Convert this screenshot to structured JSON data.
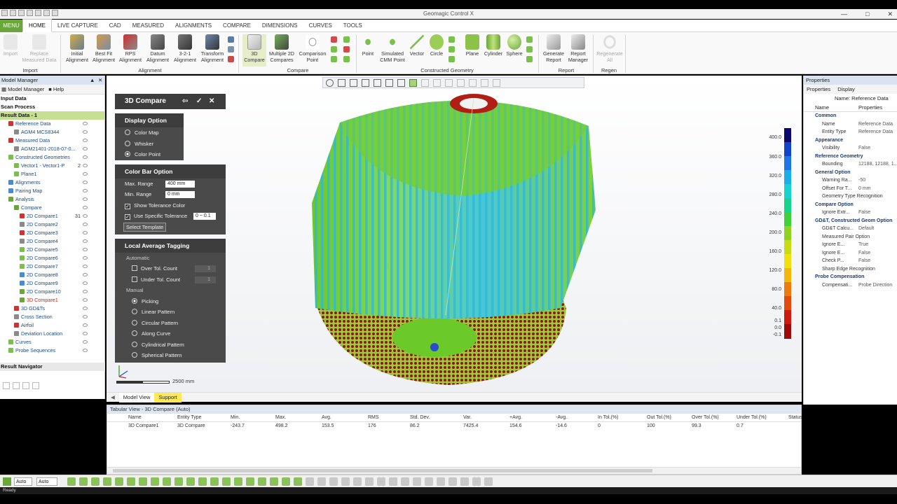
{
  "app": {
    "title": "Geomagic Control X"
  },
  "tabs": [
    "MENU",
    "HOME",
    "LIVE CAPTURE",
    "CAD",
    "MEASURED",
    "ALIGNMENTS",
    "COMPARE",
    "DIMENSIONS",
    "CURVES",
    "TOOLS"
  ],
  "ribbon": {
    "import": {
      "import": "Import",
      "replace": "Replace\nMeasured Data",
      "group": "Import"
    },
    "alignment": {
      "initial": "Initial\nAlignment",
      "bestfit": "Best Fit\nAlignment",
      "rps": "RPS\nAlignment",
      "datum": "Datum\nAlignment",
      "three21": "3-2-1\nAlignment",
      "transform": "Transform\nAlignment",
      "group": "Alignment"
    },
    "compare": {
      "compare3d": "3D\nCompare",
      "multi2d": "Multiple 2D\nCompares",
      "comparison_point": "Comparison\nPoint",
      "group": "Compare"
    },
    "geometry": {
      "point": "Point",
      "sim_cmm": "Simulated\nCMM Point",
      "vector": "Vector",
      "circle": "Circle",
      "plane": "Plane",
      "cylinder": "Cylinder",
      "sphere": "Sphere",
      "group": "Constructed Geometry"
    },
    "report": {
      "generate": "Generate\nReport",
      "manager": "Report\nManager",
      "group": "Report"
    },
    "regen": {
      "regenerate": "Regenerate\nAll",
      "group": "Regen"
    }
  },
  "model_manager": {
    "title": "Model Manager",
    "tab_manager": "Model Manager",
    "tab_help": "Help",
    "input_data": "Input Data",
    "scan_process": "Scan Process",
    "result_data": "Result Data - 1",
    "items": [
      {
        "label": "Reference Data",
        "indent": 1
      },
      {
        "label": "AGM4 MCS8344",
        "indent": 2
      },
      {
        "label": "Measured Data",
        "indent": 1
      },
      {
        "label": "AGM21401-2018-07-0...",
        "indent": 2
      },
      {
        "label": "Constructed Geometries",
        "indent": 1
      },
      {
        "label": "Vector1 - Vector1-P",
        "indent": 2,
        "num": "2"
      },
      {
        "label": "Plane1",
        "indent": 2
      },
      {
        "label": "Alignments",
        "indent": 1
      },
      {
        "label": "Pairing Map",
        "indent": 1
      },
      {
        "label": "Analysis",
        "indent": 1
      },
      {
        "label": "Compare",
        "indent": 2
      },
      {
        "label": "2D Compare1",
        "indent": 3,
        "num": "31"
      },
      {
        "label": "2D Compare2",
        "indent": 3
      },
      {
        "label": "2D Compare3",
        "indent": 3
      },
      {
        "label": "2D Compare4",
        "indent": 3
      },
      {
        "label": "2D Compare5",
        "indent": 3
      },
      {
        "label": "2D Compare6",
        "indent": 3
      },
      {
        "label": "2D Compare7",
        "indent": 3
      },
      {
        "label": "2D Compare8",
        "indent": 3
      },
      {
        "label": "2D Compare9",
        "indent": 3
      },
      {
        "label": "2D Compare10",
        "indent": 3
      },
      {
        "label": "3D Compare1",
        "indent": 3
      },
      {
        "label": "3D GD&Ts",
        "indent": 2
      },
      {
        "label": "Cross Section",
        "indent": 2
      },
      {
        "label": "Airfoil",
        "indent": 2
      },
      {
        "label": "Deviation Location",
        "indent": 2
      },
      {
        "label": "Curves",
        "indent": 1
      },
      {
        "label": "Probe Sequences",
        "indent": 1
      }
    ],
    "result_navigator": "Result Navigator"
  },
  "panel": {
    "title": "3D Compare",
    "display_option": "Display Option",
    "color_map": "Color Map",
    "whisker": "Whisker",
    "color_point": "Color Point",
    "color_bar_option": "Color Bar Option",
    "max_range_label": "Max. Range",
    "max_range_value": "400 mm",
    "min_range_label": "Min. Range",
    "min_range_value": "0 mm",
    "show_tol": "Show Tolerance Color",
    "use_spec_tol": "Use Specific Tolerance",
    "spec_tol_value": "0 ~ 0.1",
    "select_template": "Select Template",
    "local_avg": "Local Average Tagging",
    "automatic": "Automatic",
    "over_tol": "Over Tol. Count",
    "over_tol_value": "1",
    "under_tol": "Under Tol. Count",
    "under_tol_value": "1",
    "manual": "Manual",
    "picking": "Picking",
    "linear": "Linear Pattern",
    "circular": "Circular Pattern",
    "along_curve": "Along Curve",
    "cylindrical": "Cylindrical Pattern",
    "spherical": "Spherical Pattern"
  },
  "scale_label": "2500 mm",
  "colorbar": {
    "ticks": [
      "400.0",
      "360.0",
      "320.0",
      "280.0",
      "240.0",
      "200.0",
      "160.0",
      "120.0",
      "80.0",
      "40.0",
      "0.1",
      "0.0",
      "-0.1"
    ],
    "colors": [
      "#0a0a6e",
      "#1144cc",
      "#1b77e6",
      "#19aee8",
      "#16d3d0",
      "#13d68a",
      "#3fd13a",
      "#8fd21f",
      "#c9dc13",
      "#f0e10e",
      "#f5b60c",
      "#ef7a0c",
      "#e34a0c",
      "#cc1b0c",
      "#9c0a0a"
    ]
  },
  "bottom_tabs": {
    "model_view": "Model View",
    "support": "Support"
  },
  "tabular": {
    "title": "Tabular View - 3D Compare (Auto)",
    "columns": [
      "Name",
      "Entity Type",
      "Min.",
      "Max.",
      "Avg.",
      "RMS",
      "Std. Dev.",
      "Var.",
      "+Avg.",
      "-Avg.",
      "In Tol.(%)",
      "Out Tol.(%)",
      "Over Tol.(%)",
      "Under Tol.(%)",
      "Status"
    ],
    "row": [
      "3D Compare1",
      "3D Compare",
      "-243.7",
      "498.2",
      "153.5",
      "176",
      "86.2",
      "7425.4",
      "154.6",
      "-14.6",
      "0",
      "100",
      "99.3",
      "0.7",
      ""
    ]
  },
  "properties": {
    "title": "Properties",
    "tab_props": "Properties",
    "tab_display": "Display",
    "name_value": "Name: Reference Data",
    "col_name": "Name",
    "col_props": "Properties",
    "rows": [
      {
        "type": "cat",
        "k": "Common"
      },
      {
        "k": "Name",
        "v": "Reference Data"
      },
      {
        "k": "Entity Type",
        "v": "Reference Data"
      },
      {
        "type": "cat",
        "k": "Appearance"
      },
      {
        "k": "Visibility",
        "v": "False"
      },
      {
        "type": "cat",
        "k": "Reference Geometry"
      },
      {
        "k": "Bounding",
        "v": "12188, 12188, 1..."
      },
      {
        "type": "cat",
        "k": "General Option"
      },
      {
        "k": "Warning Ra...",
        "v": "-50"
      },
      {
        "k": "Offset For T...",
        "v": "0 mm"
      },
      {
        "k": "Geometry Type Recognition",
        "v": ""
      },
      {
        "type": "cat",
        "k": "Compare Option"
      },
      {
        "k": "Ignore Extr...",
        "v": "False"
      },
      {
        "type": "cat",
        "k": "GD&T, Constructed Geom Option"
      },
      {
        "k": "GD&T Calcu...",
        "v": "Default"
      },
      {
        "k": "Measured Pair Option",
        "v": ""
      },
      {
        "k": "Ignore E...",
        "v": "True"
      },
      {
        "k": "Ignore E...",
        "v": "False"
      },
      {
        "k": "Check P...",
        "v": "False"
      },
      {
        "k": "Sharp Edge Recognition",
        "v": ""
      },
      {
        "type": "cat",
        "k": "Probe Compensation"
      },
      {
        "k": "Compensati...",
        "v": "Probe Direction"
      }
    ]
  },
  "status": {
    "auto1": "Auto",
    "auto2": "Auto",
    "ready": "Ready"
  }
}
